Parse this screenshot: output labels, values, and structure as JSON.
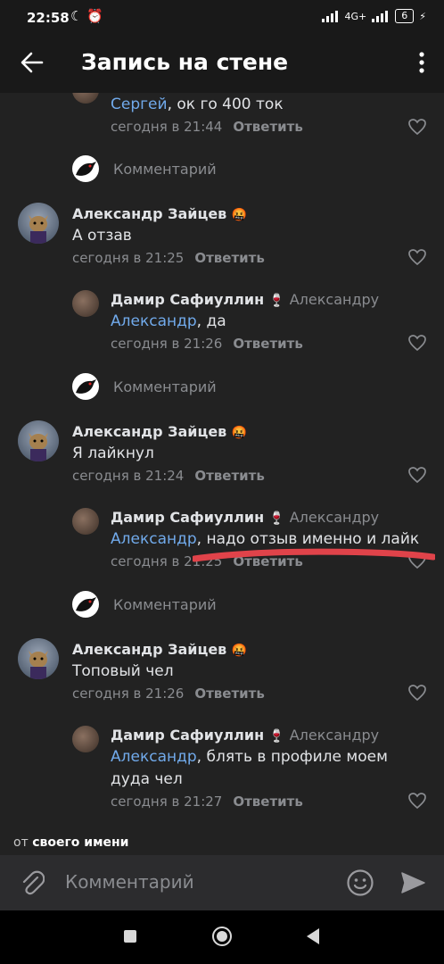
{
  "status_bar": {
    "time": "22:58",
    "network": "4G+",
    "battery": "6"
  },
  "header": {
    "title": "Запись на стене"
  },
  "feed": {
    "top_reply": {
      "mention": "Сергей",
      "text": ", ок го 400 ток",
      "time": "сегодня в 21:44",
      "reply_label": "Ответить"
    },
    "comment_placeholder": "Комментарий",
    "threads": [
      {
        "author": "Александр Зайцев",
        "author_emoji": "🤬",
        "text": "А отзав",
        "time": "сегодня в 21:25",
        "reply_label": "Ответить",
        "reply": {
          "author": "Дамир Сафиуллин",
          "author_emoji": "🍷",
          "to": "Александру",
          "mention": "Александр",
          "text": ", да",
          "text2": "",
          "time": "сегодня в 21:26",
          "reply_label": "Ответить"
        }
      },
      {
        "author": "Александр Зайцев",
        "author_emoji": "🤬",
        "text": "Я лайкнул",
        "time": "сегодня в 21:24",
        "reply_label": "Ответить",
        "reply": {
          "author": "Дамир Сафиуллин",
          "author_emoji": "🍷",
          "to": "Александру",
          "mention": "Александр",
          "text": ", надо отзыв именно и лайк",
          "text2": "",
          "time": "сегодня в 21:25",
          "reply_label": "Ответить"
        }
      },
      {
        "author": "Александр Зайцев",
        "author_emoji": "🤬",
        "text": "Топовый чел",
        "time": "сегодня в 21:26",
        "reply_label": "Ответить",
        "reply": {
          "author": "Дамир Сафиуллин",
          "author_emoji": "🍷",
          "to": "Александру",
          "mention": "Александр",
          "text": ", блять в профиле моем",
          "text2": "дуда чел",
          "time": "сегодня в 21:27",
          "reply_label": "Ответить"
        }
      }
    ]
  },
  "footer": {
    "from_prefix": "от",
    "from_value": "своего имени",
    "input_placeholder": "Комментарий"
  },
  "colors": {
    "accent": "#71aaeb",
    "background": "#222222",
    "secondary_text": "#8a8c90",
    "annotation": "#e0434a"
  }
}
